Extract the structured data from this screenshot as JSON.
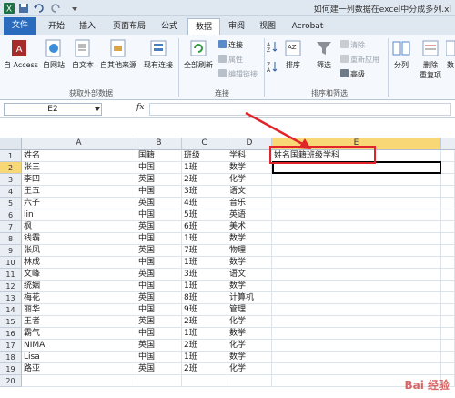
{
  "window": {
    "title": "如何建一列数据在excel中分成多列.xl"
  },
  "tabs": [
    {
      "label": "文件"
    },
    {
      "label": "开始"
    },
    {
      "label": "插入"
    },
    {
      "label": "页面布局"
    },
    {
      "label": "公式"
    },
    {
      "label": "数据"
    },
    {
      "label": "审阅"
    },
    {
      "label": "视图"
    },
    {
      "label": "Acrobat"
    }
  ],
  "active_tab": "数据",
  "ribbon": {
    "get_external": {
      "access": "自 Access",
      "web": "自网站",
      "text": "自文本",
      "other": "自其他来源",
      "existing": "现有连接",
      "label": "获取外部数据"
    },
    "connections": {
      "refresh_all": "全部刷新",
      "connections": "连接",
      "properties": "属性",
      "edit_links": "编辑链接",
      "label": "连接"
    },
    "sort_filter": {
      "sort": "排序",
      "filter": "筛选",
      "clear": "清除",
      "reapply": "重新应用",
      "advanced": "高级",
      "label": "排序和筛选"
    },
    "tools": {
      "split": "分列",
      "remove_dup": "删除",
      "remove_dup2": "重复项",
      "data_valid": "数"
    }
  },
  "formula_bar": {
    "name_box": "E2",
    "fx": "fx",
    "value": ""
  },
  "columns": [
    "A",
    "B",
    "C",
    "D",
    "E"
  ],
  "rows": [
    [
      "姓名",
      "国籍",
      "班级",
      "学科",
      "姓名国籍班级学科"
    ],
    [
      "张三",
      "中国",
      "1班",
      "数学",
      ""
    ],
    [
      "李四",
      "英国",
      "2班",
      "化学",
      ""
    ],
    [
      "王五",
      "中国",
      "3班",
      "语文",
      ""
    ],
    [
      "六子",
      "英国",
      "4班",
      "音乐",
      ""
    ],
    [
      "lin",
      "中国",
      "5班",
      "英语",
      ""
    ],
    [
      "枫",
      "英国",
      "6班",
      "美术",
      ""
    ],
    [
      "钱霸",
      "中国",
      "1班",
      "数学",
      ""
    ],
    [
      "张凤",
      "英国",
      "7班",
      "物理",
      ""
    ],
    [
      "林成",
      "中国",
      "1班",
      "数学",
      ""
    ],
    [
      "文峰",
      "英国",
      "3班",
      "语文",
      ""
    ],
    [
      "统姻",
      "中国",
      "1班",
      "数学",
      ""
    ],
    [
      "梅花",
      "英国",
      "8班",
      "计算机",
      ""
    ],
    [
      "丽华",
      "中国",
      "9班",
      "管理",
      ""
    ],
    [
      "王者",
      "英国",
      "2班",
      "化学",
      ""
    ],
    [
      "霸气",
      "中国",
      "1班",
      "数学",
      ""
    ],
    [
      "NIMA",
      "英国",
      "2班",
      "化学",
      ""
    ],
    [
      "Lisa",
      "中国",
      "1班",
      "数学",
      ""
    ],
    [
      "路亚",
      "英国",
      "2班",
      "化学",
      ""
    ]
  ],
  "watermark": "Bai 经验",
  "colors": {
    "file_tab": "#2a6bbd",
    "annotation": "#e1242a",
    "header_selected": "#f8d776"
  }
}
